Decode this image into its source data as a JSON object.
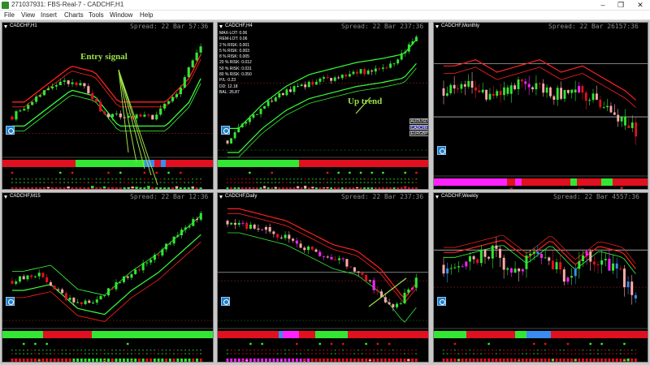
{
  "window": {
    "title": "271037931: FBS-Real-7 - CADCHF,H1",
    "minimize": "–",
    "maximize": "❐",
    "close": "✕"
  },
  "menu": [
    "File",
    "View",
    "Insert",
    "Charts",
    "Tools",
    "Window",
    "Help"
  ],
  "charts": [
    {
      "id": "h1",
      "title": "CADCHF,H1",
      "spread": "Spread: 22 Bar  57:36"
    },
    {
      "id": "h4",
      "title": "CADCHF,H4",
      "spread": "Spread: 22 Bar  237:36"
    },
    {
      "id": "mn",
      "title": "CADCHF,Monthly",
      "spread": "Spread: 22 Bar  26157:36"
    },
    {
      "id": "m15",
      "title": "CADCHF,M15",
      "spread": "Spread: 22 Bar  12:36"
    },
    {
      "id": "d1",
      "title": "CADCHF,Daily",
      "spread": "Spread: 22 Bar  237:36"
    },
    {
      "id": "w1",
      "title": "CADCHF,Weekly",
      "spread": "Spread: 22 Bar  4557:36"
    }
  ],
  "money_management": [
    "MAX-LOT: 0.06",
    "REM-LOT: 0.06",
    "2 % RISK: 0.001",
    "5 % RISK: 0.003",
    "8 % RISK: 0.005",
    "20 % RISK: 0.012",
    "50 % RISK: 0.031",
    "80 % RISK: 0.050",
    "P/L: 0.23",
    "DD: 12.18",
    "BAL: 26.87"
  ],
  "pairs": [
    "AUDUSD",
    "CADCHF",
    "EURGBP"
  ],
  "annotations": {
    "entry": "Entry signal",
    "uptrend": "Up trend"
  },
  "colors": {
    "bull": "#33e633",
    "bear": "#e01020",
    "pink": "#ffaaaa",
    "magenta": "#ff22ff",
    "blue": "#3b8cf0",
    "lime_band": "#39ff39",
    "red_band": "#ff2020"
  },
  "icons": {
    "crosshair": "crosshair-icon",
    "app": "terminal-app-icon"
  }
}
